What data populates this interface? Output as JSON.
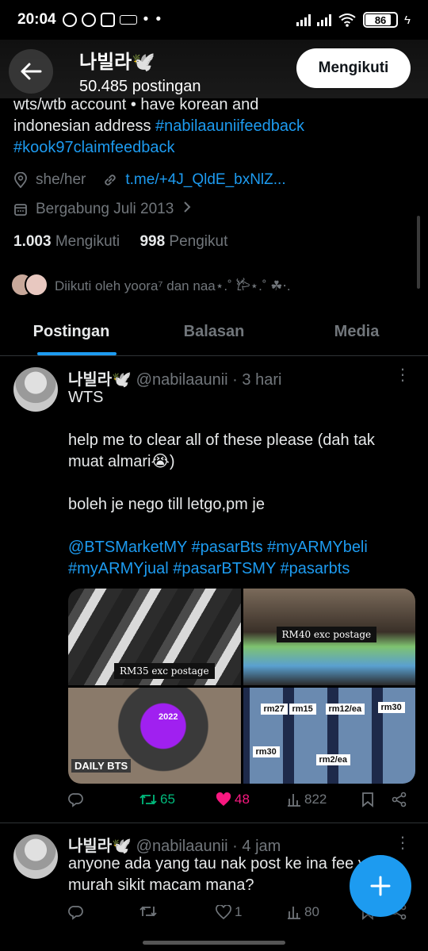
{
  "status_bar": {
    "time": "20:04",
    "dots": "• •",
    "battery": "86"
  },
  "header": {
    "name": "나빌라🕊️",
    "post_count": "50.485 postingan",
    "follow_button": "Mengikuti"
  },
  "profile": {
    "bio_line1": "wts/wtb account • have korean and",
    "bio_line2_text": "indonesian address ",
    "bio_hashtag1": "#nabilaauniifeedback",
    "bio_hashtag2": "#kook97claimfeedback",
    "pronouns": "she/her",
    "link": "t.me/+4J_QldE_bxNlZ...",
    "joined": "Bergabung Juli 2013",
    "following_count": "1.003",
    "following_label": " Mengikuti",
    "followers_count": "998",
    "followers_label": " Pengikut",
    "followed_by": "Diikuti oleh yoora⁷ dan naa⋆.˚ 𐂂⋆.˚ ☘︎⋅."
  },
  "tabs": [
    {
      "label": "Postingan",
      "active": true
    },
    {
      "label": "Balasan",
      "active": false
    },
    {
      "label": "Media",
      "active": false
    }
  ],
  "tweets": [
    {
      "name": "나빌라🕊️",
      "handle": "@nabilaaunii",
      "time": "· 3 hari",
      "lines": [
        "WTS",
        "",
        "help me to clear all of these please (dah tak muat almari😭)",
        "",
        "boleh je nego till letgo,pm je",
        ""
      ],
      "hashtags_line1": "@BTSMarketMY #pasarBts #myARMYbeli",
      "hashtags_line2": "#myARMYjual #pasarBTSMY #pasarbts",
      "media_labels": [
        "RM35  exc postage",
        "RM40  exc postage",
        "rm27",
        "rm15",
        "rm12/ea",
        "rm30",
        "rm30",
        "rm2/ea",
        "DAILY BTS",
        "2022"
      ],
      "retweets": "65",
      "likes": "48",
      "views": "822"
    },
    {
      "name": "나빌라🕊️",
      "handle": "@nabilaaunii",
      "time": "· 4 jam",
      "line1": "anyone ada yang tau nak post ke ina fee yang",
      "line2": "murah sikit macam mana?",
      "retweets": "",
      "likes": "1",
      "views": "80"
    }
  ],
  "colors": {
    "accent": "#1d9bf0",
    "retweet": "#00ba7c",
    "like": "#f91880",
    "muted": "#71767b"
  }
}
